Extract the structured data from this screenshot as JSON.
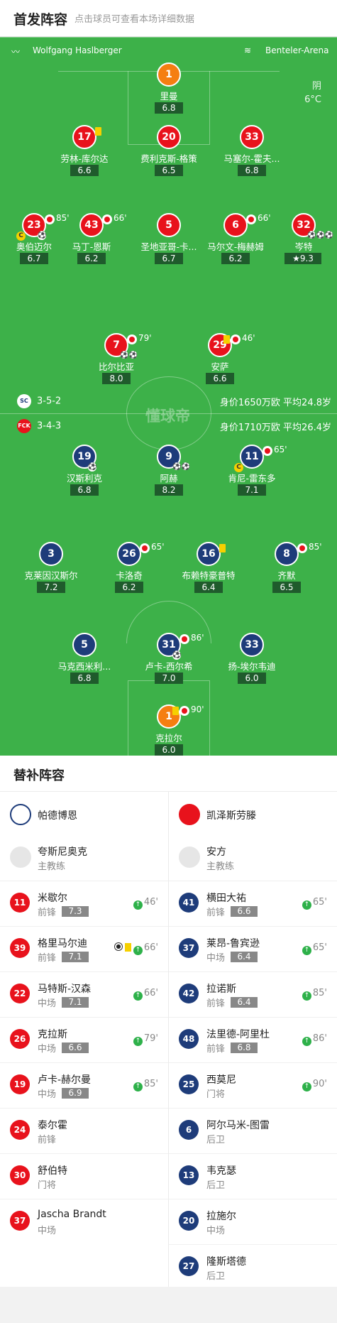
{
  "header": {
    "title": "首发阵容",
    "subtitle": "点击球员可查看本场详细数据"
  },
  "pitch": {
    "referee": "Wolfgang Haslberger",
    "stadium": "Benteler-Arena",
    "weather": "阴",
    "temperature": "6°C",
    "watermark": "懂球帝",
    "home": {
      "formation": "3-5-2",
      "value": "身价1650万欧 平均24.8岁",
      "color": "#e8121c"
    },
    "away": {
      "formation": "3-4-3",
      "value": "身价1710万欧 平均26.4岁",
      "color": "#1e3c7a"
    },
    "players": [
      {
        "num": "1",
        "name": "里曼",
        "rating": "6.8",
        "cls": "o"
      },
      {
        "num": "17",
        "name": "劳林-库尔达",
        "rating": "6.6",
        "cls": "r",
        "yellow": true
      },
      {
        "num": "20",
        "name": "费利克斯-格策",
        "rating": "6.5",
        "cls": "r"
      },
      {
        "num": "33",
        "name": "马塞尔-霍夫...",
        "rating": "6.8",
        "cls": "r"
      },
      {
        "num": "23",
        "name": "奥伯迈尔",
        "rating": "6.7",
        "cls": "r",
        "sub": "85'",
        "captain": true,
        "ball": true
      },
      {
        "num": "43",
        "name": "马丁-恩斯",
        "rating": "6.2",
        "cls": "r",
        "sub": "66'"
      },
      {
        "num": "5",
        "name": "圣地亚哥-卡...",
        "rating": "6.7",
        "cls": "r"
      },
      {
        "num": "6",
        "name": "马尔文-梅赫姆",
        "rating": "6.2",
        "cls": "r",
        "sub": "66'"
      },
      {
        "num": "32",
        "name": "岑特",
        "rating": "9.3",
        "cls": "r",
        "star": true,
        "balls": "⚽⚽⚽"
      },
      {
        "num": "7",
        "name": "比尔比亚",
        "rating": "8.0",
        "cls": "r",
        "sub": "79'",
        "balls": "⚽⚽"
      },
      {
        "num": "29",
        "name": "安萨",
        "rating": "6.6",
        "cls": "r",
        "sub": "46'",
        "yellow": true
      },
      {
        "num": "19",
        "name": "汉斯利克",
        "rating": "6.8",
        "cls": "b",
        "ball": true
      },
      {
        "num": "9",
        "name": "阿赫",
        "rating": "8.2",
        "cls": "b",
        "balls": "⚽⚽"
      },
      {
        "num": "11",
        "name": "肯尼-雷东多",
        "rating": "7.1",
        "cls": "b",
        "sub": "65'",
        "captain": true
      },
      {
        "num": "3",
        "name": "克莱因汉斯尔",
        "rating": "7.2",
        "cls": "b"
      },
      {
        "num": "26",
        "name": "卡洛奇",
        "rating": "6.2",
        "cls": "b",
        "sub": "65'"
      },
      {
        "num": "16",
        "name": "布赖特豪普特",
        "rating": "6.4",
        "cls": "b",
        "yellow": true
      },
      {
        "num": "8",
        "name": "齐默",
        "rating": "6.5",
        "cls": "b",
        "sub": "85'"
      },
      {
        "num": "5",
        "name": "马克西米利...",
        "rating": "6.8",
        "cls": "b"
      },
      {
        "num": "31",
        "name": "卢卡-西尔希",
        "rating": "7.0",
        "cls": "b",
        "sub": "86'",
        "ball": true
      },
      {
        "num": "33",
        "name": "扬-埃尔韦迪",
        "rating": "6.0",
        "cls": "b"
      },
      {
        "num": "1",
        "name": "克拉尔",
        "rating": "6.0",
        "cls": "o",
        "sub": "90'",
        "yellow": true
      }
    ]
  },
  "bench": {
    "title": "替补阵容",
    "home": {
      "team": "帕德博恩",
      "coach": "夸斯尼奥克",
      "coach_role": "主教练",
      "subs": [
        {
          "num": "11",
          "name": "米歇尔",
          "pos": "前锋",
          "rating": "7.3",
          "in": "46'"
        },
        {
          "num": "39",
          "name": "格里马尔迪",
          "pos": "前锋",
          "rating": "7.1",
          "in": "66'",
          "yellow": true,
          "ball": true
        },
        {
          "num": "22",
          "name": "马特斯-汉森",
          "pos": "中场",
          "rating": "7.1",
          "in": "66'"
        },
        {
          "num": "26",
          "name": "克拉斯",
          "pos": "中场",
          "rating": "6.6",
          "in": "79'"
        },
        {
          "num": "19",
          "name": "卢卡-赫尔曼",
          "pos": "中场",
          "rating": "6.9",
          "in": "85'"
        },
        {
          "num": "24",
          "name": "泰尔霍",
          "pos": "前锋"
        },
        {
          "num": "30",
          "name": "舒伯特",
          "pos": "门将"
        },
        {
          "num": "37",
          "name": "Jascha Brandt",
          "pos": "中场"
        }
      ]
    },
    "away": {
      "team": "凯泽斯劳滕",
      "coach": "安方",
      "coach_role": "主教练",
      "subs": [
        {
          "num": "41",
          "name": "横田大祐",
          "pos": "前锋",
          "rating": "6.6",
          "in": "65'"
        },
        {
          "num": "37",
          "name": "莱昂-鲁宾逊",
          "pos": "中场",
          "rating": "6.4",
          "in": "65'"
        },
        {
          "num": "42",
          "name": "拉诺斯",
          "pos": "前锋",
          "rating": "6.4",
          "in": "85'"
        },
        {
          "num": "48",
          "name": "法里德-阿里杜",
          "pos": "前锋",
          "rating": "6.8",
          "in": "86'"
        },
        {
          "num": "25",
          "name": "西莫尼",
          "pos": "门将",
          "in": "90'"
        },
        {
          "num": "6",
          "name": "阿尔马米-图雷",
          "pos": "后卫"
        },
        {
          "num": "13",
          "name": "韦克瑟",
          "pos": "后卫"
        },
        {
          "num": "20",
          "name": "拉施尔",
          "pos": "中场"
        },
        {
          "num": "27",
          "name": "隆斯塔德",
          "pos": "后卫"
        }
      ]
    }
  }
}
